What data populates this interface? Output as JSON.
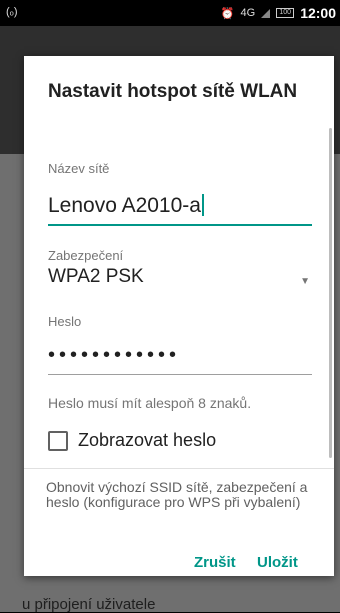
{
  "status_bar": {
    "left_icon_text": "(ₒ)",
    "alarm_icon": "alarm-icon",
    "network_label": "4G",
    "battery_level": "100",
    "time": "12:00"
  },
  "background": {
    "bottom_text": "u připojení uživatele"
  },
  "dialog": {
    "title": "Nastavit hotspot sítě WLAN",
    "ssid_label": "Název sítě",
    "ssid_value": "Lenovo A2010-a",
    "security_label": "Zabezpečení",
    "security_value": "WPA2 PSK",
    "password_label": "Heslo",
    "password_value": "••••••••••••",
    "password_hint": "Heslo musí mít alespoň 8 znaků.",
    "show_password_label": "Zobrazovat heslo",
    "show_password_checked": false,
    "reset_text": "Obnovit výchozí SSID sítě, zabezpečení a heslo (konfigurace pro WPS při vybalení)",
    "cancel_label": "Zrušit",
    "save_label": "Uložit"
  },
  "colors": {
    "accent": "#009688",
    "scrim": "#6f6f6f",
    "appbar": "#2e2e2e"
  }
}
